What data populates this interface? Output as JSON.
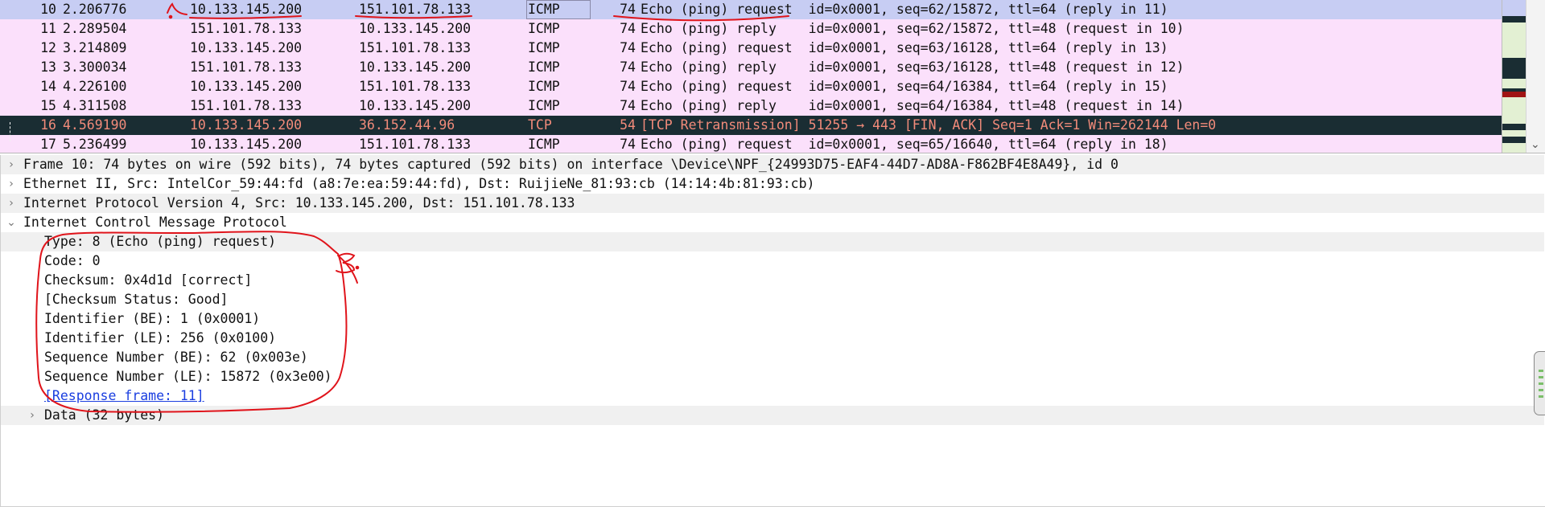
{
  "packet_list": {
    "rows": [
      {
        "no": "10",
        "time": "2.206776",
        "src": "10.133.145.200",
        "dst": "151.101.78.133",
        "proto": "ICMP",
        "len": "74",
        "info": "Echo (ping) request  id=0x0001, seq=62/15872, ttl=64 (reply in 11)",
        "style": "selected"
      },
      {
        "no": "11",
        "time": "2.289504",
        "src": "151.101.78.133",
        "dst": "10.133.145.200",
        "proto": "ICMP",
        "len": "74",
        "info": "Echo (ping) reply    id=0x0001, seq=62/15872, ttl=48 (request in 10)",
        "style": "icmp"
      },
      {
        "no": "12",
        "time": "3.214809",
        "src": "10.133.145.200",
        "dst": "151.101.78.133",
        "proto": "ICMP",
        "len": "74",
        "info": "Echo (ping) request  id=0x0001, seq=63/16128, ttl=64 (reply in 13)",
        "style": "icmp"
      },
      {
        "no": "13",
        "time": "3.300034",
        "src": "151.101.78.133",
        "dst": "10.133.145.200",
        "proto": "ICMP",
        "len": "74",
        "info": "Echo (ping) reply    id=0x0001, seq=63/16128, ttl=48 (request in 12)",
        "style": "icmp"
      },
      {
        "no": "14",
        "time": "4.226100",
        "src": "10.133.145.200",
        "dst": "151.101.78.133",
        "proto": "ICMP",
        "len": "74",
        "info": "Echo (ping) request  id=0x0001, seq=64/16384, ttl=64 (reply in 15)",
        "style": "icmp"
      },
      {
        "no": "15",
        "time": "4.311508",
        "src": "151.101.78.133",
        "dst": "10.133.145.200",
        "proto": "ICMP",
        "len": "74",
        "info": "Echo (ping) reply    id=0x0001, seq=64/16384, ttl=48 (request in 14)",
        "style": "icmp"
      },
      {
        "no": "16",
        "time": "4.569190",
        "src": "10.133.145.200",
        "dst": "36.152.44.96",
        "proto": "TCP",
        "len": "54",
        "info": "[TCP Retransmission] 51255 → 443 [FIN, ACK] Seq=1 Ack=1 Win=262144 Len=0",
        "style": "tcp"
      },
      {
        "no": "17",
        "time": "5.236499",
        "src": "10.133.145.200",
        "dst": "151.101.78.133",
        "proto": "ICMP",
        "len": "74",
        "info": "Echo (ping) request  id=0x0001, seq=65/16640, ttl=64 (reply in 18)",
        "style": "icmp"
      }
    ],
    "row_arrow_request": "→",
    "row_arrow_reply": "←"
  },
  "details": {
    "frame": "Frame 10: 74 bytes on wire (592 bits), 74 bytes captured (592 bits) on interface \\Device\\NPF_{24993D75-EAF4-44D7-AD8A-F862BF4E8A49}, id 0",
    "ethernet": "Ethernet II, Src: IntelCor_59:44:fd (a8:7e:ea:59:44:fd), Dst: RuijieNe_81:93:cb (14:14:4b:81:93:cb)",
    "ip": "Internet Protocol Version 4, Src: 10.133.145.200, Dst: 151.101.78.133",
    "icmp": "Internet Control Message Protocol",
    "icmp_fields": [
      "Type: 8 (Echo (ping) request)",
      "Code: 0",
      "Checksum: 0x4d1d [correct]",
      "[Checksum Status: Good]",
      "Identifier (BE): 1 (0x0001)",
      "Identifier (LE): 256 (0x0100)",
      "Sequence Number (BE): 62 (0x003e)",
      "Sequence Number (LE): 15872 (0x3e00)"
    ],
    "response_link": "[Response frame: 11]",
    "data": "Data (32 bytes)"
  },
  "icons": {
    "collapsed": "chevron-right-icon",
    "expanded": "chevron-down-icon",
    "collapsed_glyph": "›",
    "expanded_glyph": "⌄",
    "scroll_down_glyph": "⌄"
  },
  "annotations": {
    "mark_1": "1.",
    "mark_3": "3."
  },
  "colors": {
    "icmp_row": "#fbe0fb",
    "selected_row": "#c7cdf3",
    "tcp_row_bg": "#1a2d33",
    "tcp_row_fg": "#f28b7a",
    "annotation": "#e0141b",
    "link": "#1a3ee0"
  }
}
